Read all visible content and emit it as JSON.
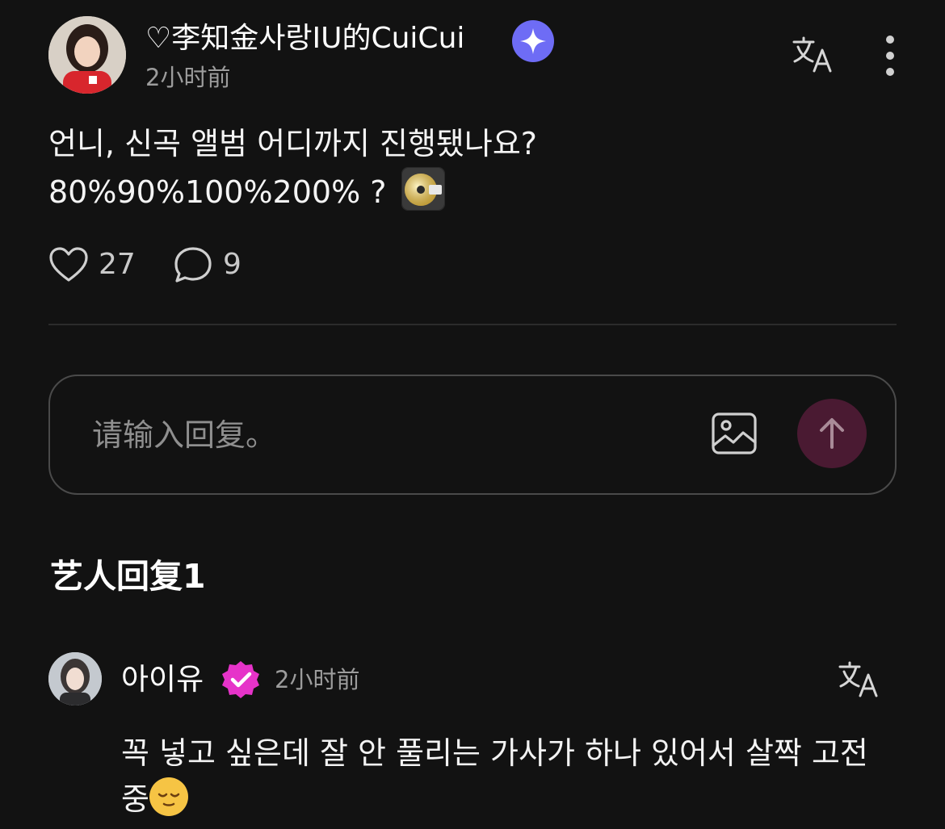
{
  "post": {
    "username": "♡李知金사랑IU的CuiCui",
    "time": "2小时前",
    "body_line1": "언니, 신곡 앨범 어디까지 진행됐나요?",
    "body_line2": "80%90%100%200% ? ",
    "likes": "27",
    "comments": "9"
  },
  "reply_box": {
    "placeholder": "请输入回复。"
  },
  "artist_replies": {
    "title": "艺人回复1",
    "items": [
      {
        "name": "아이유",
        "time": "2小时前",
        "text": "꼭 넣고 싶은데 잘 안 풀리는 가사가 하나 있어서 살짝 고전 중"
      }
    ]
  },
  "icons": {
    "verified": "sparkle-verified-icon",
    "translate": "translate-icon",
    "more": "more-vertical-icon",
    "like": "heart-icon",
    "comment": "comment-bubble-icon",
    "image": "image-icon",
    "send": "arrow-up-icon",
    "artist_badge": "verified-check-icon"
  },
  "colors": {
    "background": "#121212",
    "verified_star": "#6e6cf5",
    "artist_badge": "#e633c9",
    "send_button": "#4a1a32"
  }
}
